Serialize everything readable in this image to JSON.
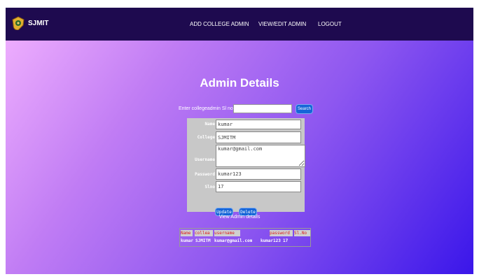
{
  "brand": {
    "title": "SJMIT"
  },
  "nav": {
    "items": [
      "ADD COLLEGE ADMIN",
      "VIEW/EDIT ADMIN",
      "LOGOUT"
    ]
  },
  "page": {
    "title": "Admin Details"
  },
  "search": {
    "label": "Enter collegeadmin Sl no",
    "value": "",
    "button": "Search"
  },
  "form": {
    "fields": [
      {
        "label": "Name",
        "value": "kumar"
      },
      {
        "label": "College",
        "value": "SJMITM"
      },
      {
        "label": "Username",
        "value": "kumar@gmail.com"
      },
      {
        "label": "Password",
        "value": "kumar123"
      },
      {
        "label": "Slno",
        "value": "17"
      }
    ],
    "update_label": "Update",
    "delete_label": "Delete"
  },
  "view": {
    "label": "View Admin details"
  },
  "table": {
    "headers": [
      "Name",
      "collea",
      "username",
      "password",
      "Sl.No"
    ],
    "rows": [
      [
        "kumar",
        "SJMITM",
        "kumar@gmail.com",
        "kumar123",
        "17"
      ]
    ]
  },
  "colors": {
    "navbar": "#1e0a4f",
    "button": "#1565d8",
    "header_text": "#d81b1b"
  },
  "icons": {
    "logo": "college-emblem-icon"
  }
}
